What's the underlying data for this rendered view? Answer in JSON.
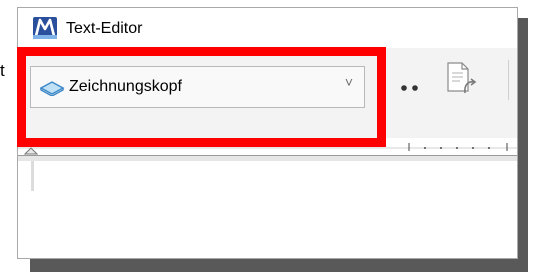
{
  "left_fragment": "t",
  "window": {
    "title": "Text-Editor",
    "app_icon": "microstation-icon"
  },
  "ribbon": {
    "style_combo": {
      "value": "Zeichnungskopf",
      "icon": "text-style-icon",
      "arrow": "˅"
    },
    "more_icon": "more-dots-icon",
    "paste_icon": "paste-icon"
  },
  "highlight": {
    "color": "#ff0000"
  },
  "colors": {
    "shadow": "#595959",
    "ribbon_bg": "#f3f3f3",
    "combo_bg": "#f9f9f9"
  }
}
